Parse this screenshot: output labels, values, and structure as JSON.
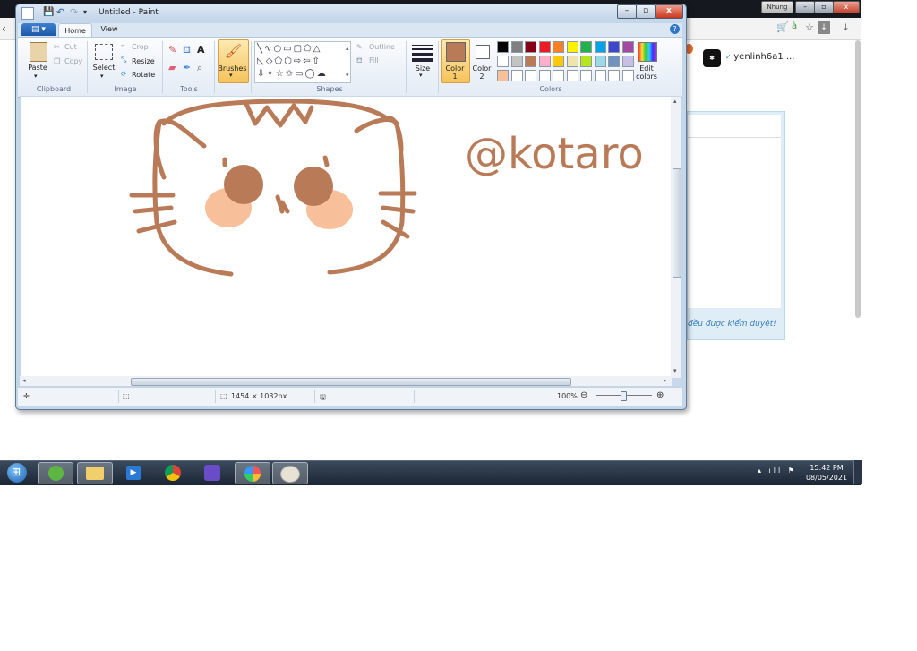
{
  "background_browser": {
    "top_button": "Nhung",
    "username": "yenlinh6a1 ...",
    "review_note": "đều được kiểm duyệt!"
  },
  "paint": {
    "title": "Untitled - Paint",
    "tabs": {
      "file": "▤ ▾",
      "home": "Home",
      "view": "View"
    },
    "clipboard": {
      "paste": "Paste",
      "cut": "Cut",
      "copy": "Copy",
      "label": "Clipboard"
    },
    "image": {
      "select": "Select",
      "crop": "Crop",
      "resize": "Resize",
      "rotate": "Rotate",
      "label": "Image"
    },
    "tools": {
      "label": "Tools"
    },
    "brushes": {
      "label": "Brushes"
    },
    "shapes": {
      "outline": "Outline",
      "fill": "Fill",
      "label": "Shapes"
    },
    "size": {
      "label": "Size"
    },
    "colors": {
      "color1_label": "Color\n1",
      "color2_label": "Color\n2",
      "edit_label": "Edit\ncolors",
      "label": "Colors",
      "color1": "#b97a57",
      "color2": "#ffffff",
      "palette_row1": [
        "#000000",
        "#7f7f7f",
        "#880015",
        "#ed1c24",
        "#ff7f27",
        "#fff200",
        "#22b14c",
        "#00a2e8",
        "#3f48cc",
        "#a349a4"
      ],
      "palette_row2": [
        "#ffffff",
        "#c3c3c3",
        "#b97a57",
        "#ffaec9",
        "#ffc90e",
        "#efe4b0",
        "#b5e61d",
        "#99d9ea",
        "#7092be",
        "#c8bfe7"
      ],
      "palette_row3": [
        "#f8c09a",
        "#ffffff",
        "#ffffff",
        "#ffffff",
        "#ffffff",
        "#ffffff",
        "#ffffff",
        "#ffffff",
        "#ffffff",
        "#ffffff"
      ]
    },
    "canvas": {
      "drawing_text": "@kotaro",
      "stroke_color": "#b97a57",
      "eye_color": "#b97a57",
      "cheek_color": "#f8c09a"
    },
    "status": {
      "dimensions": "1454 × 1032px",
      "zoom": "100%"
    }
  },
  "taskbar": {
    "time": "15:42 PM",
    "date": "08/05/2021"
  }
}
